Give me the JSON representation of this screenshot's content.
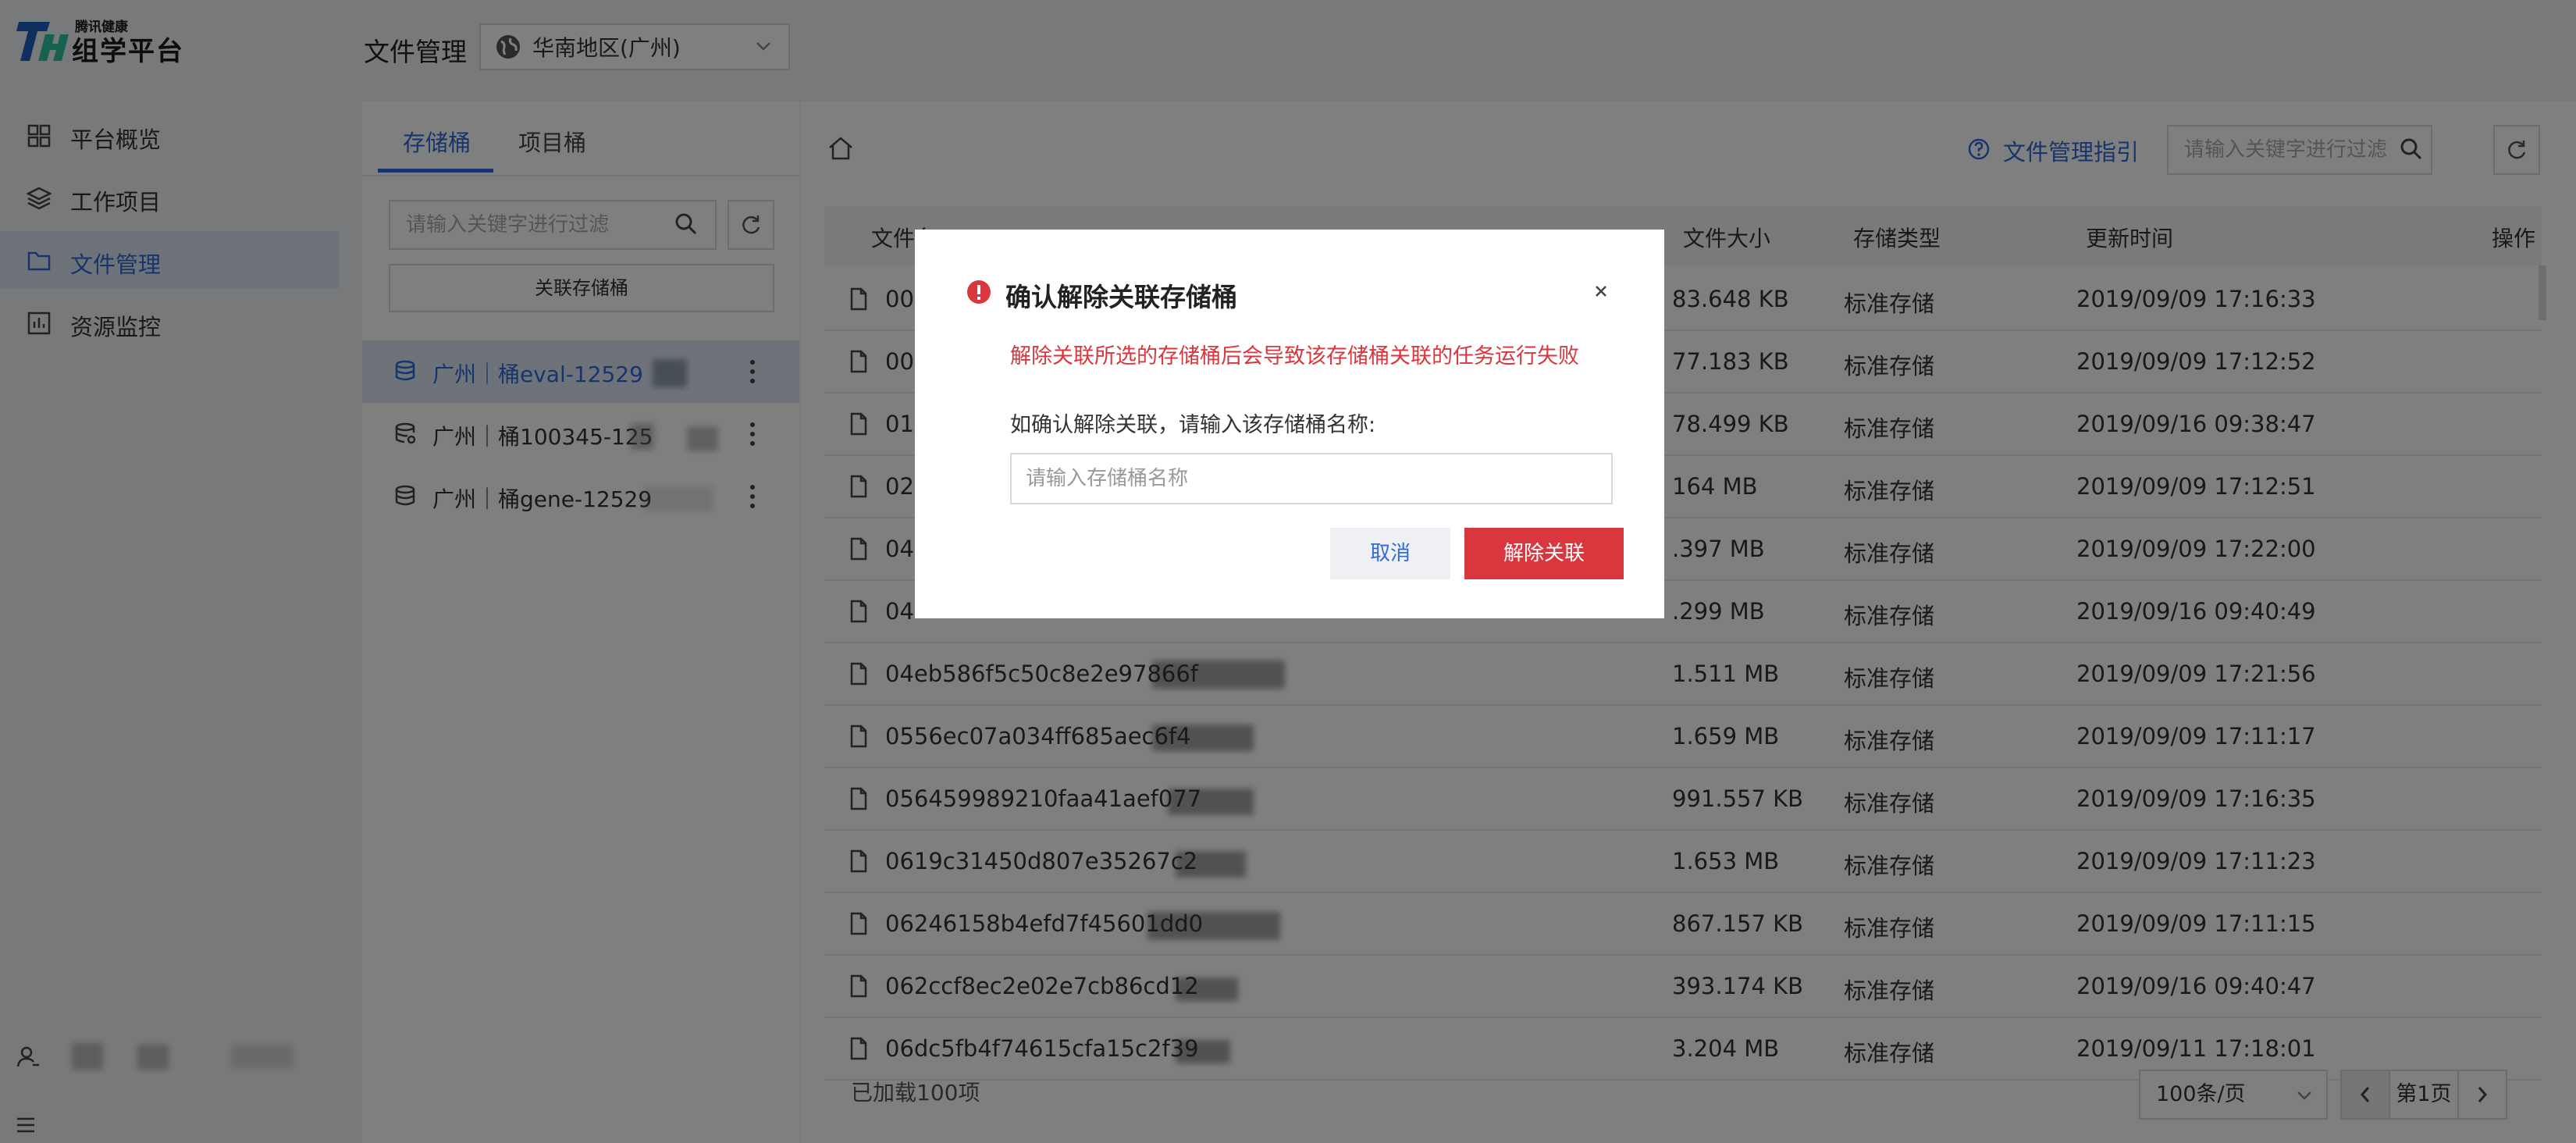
{
  "app": {
    "logo_small": "腾讯健康",
    "logo_main": "组学平台",
    "page_title": "文件管理",
    "region": "华南地区(广州)"
  },
  "sidebar": {
    "items": [
      {
        "label": "平台概览",
        "icon": "grid-icon"
      },
      {
        "label": "工作项目",
        "icon": "layers-icon"
      },
      {
        "label": "文件管理",
        "icon": "folder-icon"
      },
      {
        "label": "资源监控",
        "icon": "chart-icon"
      }
    ]
  },
  "buckets_panel": {
    "tabs": [
      "存储桶",
      "项目桶"
    ],
    "filter_placeholder": "请输入关键字进行过滤",
    "associate_label": "关联存储桶",
    "items": [
      {
        "label": "广州｜桶eval-12529"
      },
      {
        "label": "广州｜桶100345-125"
      },
      {
        "label": "广州｜桶gene-12529"
      }
    ]
  },
  "main": {
    "guide_link": "文件管理指引",
    "filter_placeholder": "请输入关键字进行过滤",
    "columns": [
      "文件名",
      "文件大小",
      "存储类型",
      "更新时间",
      "操作"
    ],
    "rows": [
      {
        "name": "00",
        "size": "83.648 KB",
        "type": "标准存储",
        "time": "2019/09/09 17:16:33"
      },
      {
        "name": "00",
        "size": "77.183 KB",
        "type": "标准存储",
        "time": "2019/09/09 17:12:52"
      },
      {
        "name": "01a",
        "size": "78.499 KB",
        "type": "标准存储",
        "time": "2019/09/16 09:38:47"
      },
      {
        "name": "02",
        "size": "164 MB",
        "type": "标准存储",
        "time": "2019/09/09 17:12:51"
      },
      {
        "name": "04",
        "size": ".397 MB",
        "type": "标准存储",
        "time": "2019/09/09 17:22:00"
      },
      {
        "name": "04",
        "size": ".299 MB",
        "type": "标准存储",
        "time": "2019/09/16 09:40:49"
      },
      {
        "name": "04eb586f5c50c8e2e97866f",
        "size": "1.511 MB",
        "type": "标准存储",
        "time": "2019/09/09 17:21:56"
      },
      {
        "name": "0556ec07a034ff685aec6f4",
        "size": "1.659 MB",
        "type": "标准存储",
        "time": "2019/09/09 17:11:17"
      },
      {
        "name": "056459989210faa41aef077",
        "size": "991.557 KB",
        "type": "标准存储",
        "time": "2019/09/09 17:16:35"
      },
      {
        "name": "0619c31450d807e35267c2",
        "size": "1.653 MB",
        "type": "标准存储",
        "time": "2019/09/09 17:11:23"
      },
      {
        "name": "06246158b4efd7f45601dd0",
        "size": "867.157 KB",
        "type": "标准存储",
        "time": "2019/09/09 17:11:15"
      },
      {
        "name": "062ccf8ec2e02e7cb86cd12",
        "size": "393.174 KB",
        "type": "标准存储",
        "time": "2019/09/16 09:40:47"
      },
      {
        "name": "06dc5fb4f74615cfa15c2f39",
        "size": "3.204 MB",
        "type": "标准存储",
        "time": "2019/09/11 17:18:01"
      }
    ],
    "loaded_count": "已加载100项",
    "per_page": "100条/页",
    "page": "第1页"
  },
  "modal": {
    "title": "确认解除关联存储桶",
    "warning": "解除关联所选的存储桶后会导致该存储桶关联的任务运行失败",
    "prompt": "如确认解除关联，请输入该存储桶名称:",
    "input_placeholder": "请输入存储桶名称",
    "cancel": "取消",
    "confirm": "解除关联"
  },
  "colors": {
    "accent": "#2f6bd8",
    "danger": "#d9363e",
    "active_bg": "#dde6f5"
  }
}
